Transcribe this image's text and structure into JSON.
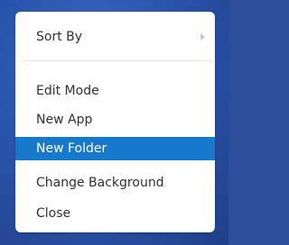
{
  "context_menu": {
    "items": [
      {
        "label": "Sort By",
        "has_submenu": true,
        "highlighted": false
      },
      {
        "label": "Edit Mode",
        "has_submenu": false,
        "highlighted": false
      },
      {
        "label": "New App",
        "has_submenu": false,
        "highlighted": false
      },
      {
        "label": "New Folder",
        "has_submenu": false,
        "highlighted": true
      },
      {
        "label": "Change Background",
        "has_submenu": false,
        "highlighted": false
      },
      {
        "label": "Close",
        "has_submenu": false,
        "highlighted": false
      }
    ],
    "submenu_icon": "chevron-right-icon",
    "colors": {
      "background": "#2a56b0",
      "menu": "#ffffff",
      "highlight": "#1679cc",
      "text": "#303030"
    }
  }
}
